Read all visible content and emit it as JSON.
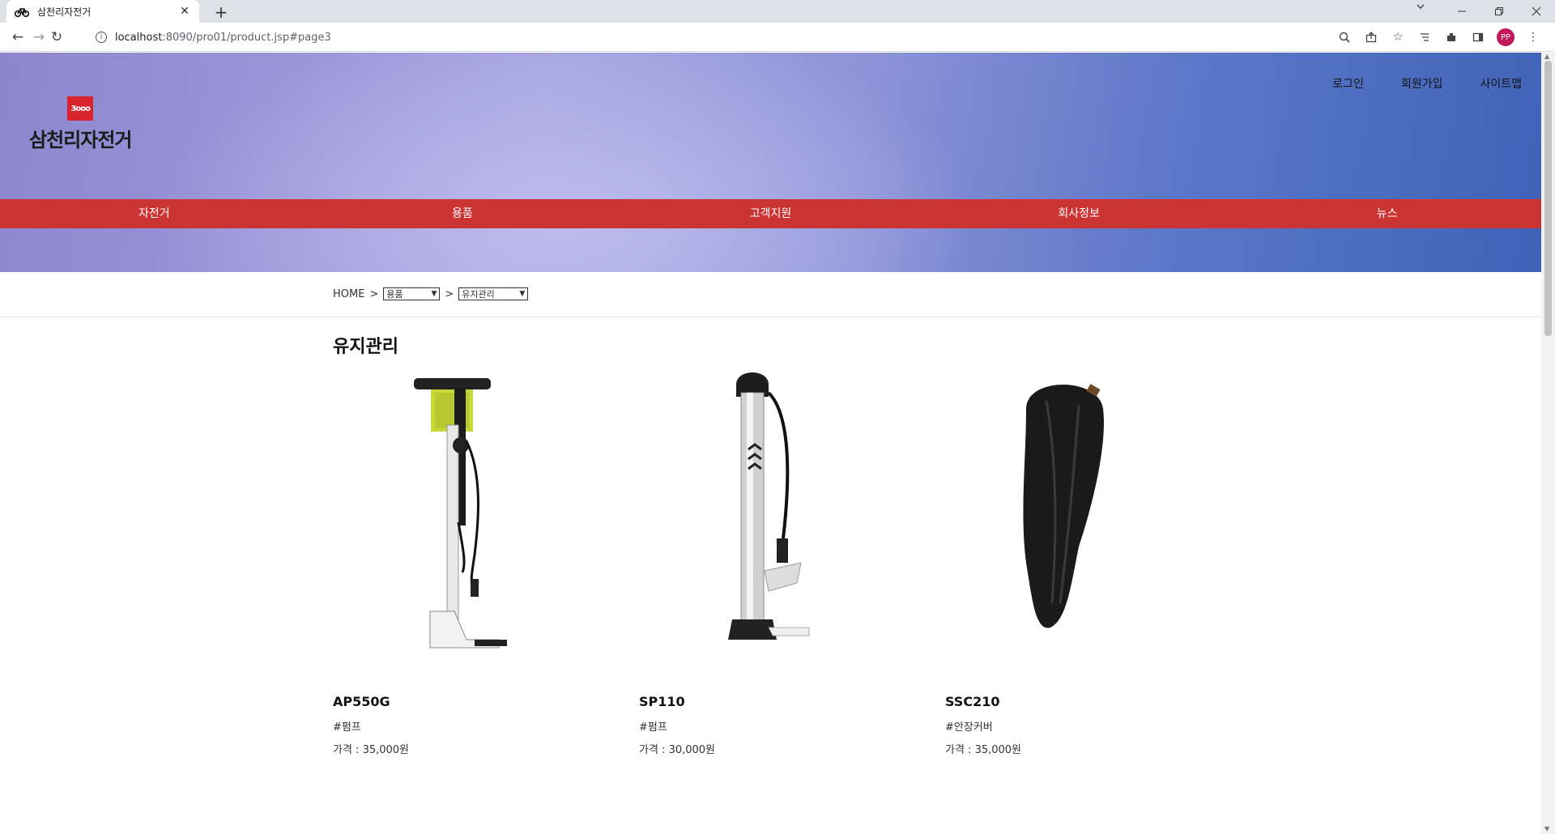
{
  "browser": {
    "tab_title": "삼천리자전거",
    "new_tab": "+",
    "tab_close": "✕",
    "url_host": "localhost",
    "url_rest": ":8090/pro01/product.jsp#page3",
    "profile_initials": "PP"
  },
  "site": {
    "logo_text": "삼천리자전거",
    "logo_mark": "3ooo",
    "top_links": [
      "로그인",
      "회원가입",
      "사이트맵"
    ],
    "menu": [
      "자전거",
      "용품",
      "고객지원",
      "회사정보",
      "뉴스"
    ]
  },
  "breadcrumb": {
    "home": "HOME",
    "separator": ">",
    "category_select": "용품",
    "subcategory_select": "유지관리"
  },
  "page_title": "유지관리",
  "products": [
    {
      "name": "AP550G",
      "tag": "#펌프",
      "price": "가격 : 35,000원",
      "image": "floor-pump-white"
    },
    {
      "name": "SP110",
      "tag": "#펌프",
      "price": "가격 : 30,000원",
      "image": "floor-pump-silver"
    },
    {
      "name": "SSC210",
      "tag": "#안장커버",
      "price": "가격 : 35,000원",
      "image": "saddle-cover-black"
    }
  ],
  "colors": {
    "menu_bar": "#cc3333",
    "logo_red": "#d9232a",
    "hero_blue": "#3f62b8"
  }
}
